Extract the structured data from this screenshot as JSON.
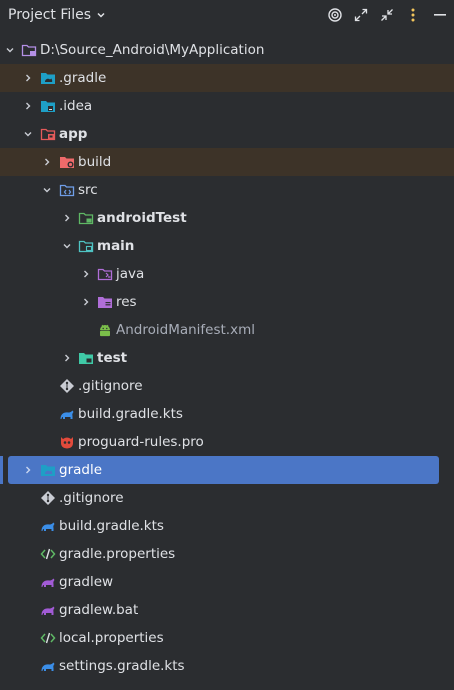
{
  "header": {
    "title": "Project Files",
    "icons": [
      "target-icon",
      "expand-all-icon",
      "collapse-all-icon",
      "more-options-icon",
      "minimize-icon"
    ]
  },
  "tree": [
    {
      "label": "D:\\Source_Android\\MyApplication",
      "icon": "module-folder-icon",
      "expanded": true
    },
    {
      "label": ".gradle",
      "icon": "gradle-folder-icon",
      "expanded": false
    },
    {
      "label": ".idea",
      "icon": "idea-folder-icon",
      "expanded": false
    },
    {
      "label": "app",
      "icon": "app-module-folder-icon",
      "expanded": true
    },
    {
      "label": "build",
      "icon": "build-folder-icon",
      "expanded": false
    },
    {
      "label": "src",
      "icon": "source-folder-icon",
      "expanded": true
    },
    {
      "label": "androidTest",
      "icon": "test-folder-icon",
      "expanded": false
    },
    {
      "label": "main",
      "icon": "main-folder-icon",
      "expanded": true
    },
    {
      "label": "java",
      "icon": "java-folder-icon",
      "expanded": false
    },
    {
      "label": "res",
      "icon": "res-folder-icon",
      "expanded": false
    },
    {
      "label": "AndroidManifest.xml",
      "icon": "android-icon"
    },
    {
      "label": "test",
      "icon": "test-folder-icon",
      "expanded": false
    },
    {
      "label": ".gitignore",
      "icon": "git-icon"
    },
    {
      "label": "build.gradle.kts",
      "icon": "gradle-elephant-icon"
    },
    {
      "label": "proguard-rules.pro",
      "icon": "proguard-icon"
    },
    {
      "label": "gradle",
      "icon": "gradle-folder-icon",
      "expanded": false,
      "selected": true
    },
    {
      "label": ".gitignore",
      "icon": "git-icon"
    },
    {
      "label": "build.gradle.kts",
      "icon": "gradle-elephant-icon"
    },
    {
      "label": "gradle.properties",
      "icon": "properties-icon"
    },
    {
      "label": "gradlew",
      "icon": "gradlew-icon"
    },
    {
      "label": "gradlew.bat",
      "icon": "gradlew-icon"
    },
    {
      "label": "local.properties",
      "icon": "properties-icon"
    },
    {
      "label": "settings.gradle.kts",
      "icon": "gradle-elephant-icon"
    }
  ],
  "colors": {
    "background": "#2b2d30",
    "selection": "#4b76c6",
    "excluded_highlight": "#3d3328",
    "text": "#dfe1e5"
  }
}
